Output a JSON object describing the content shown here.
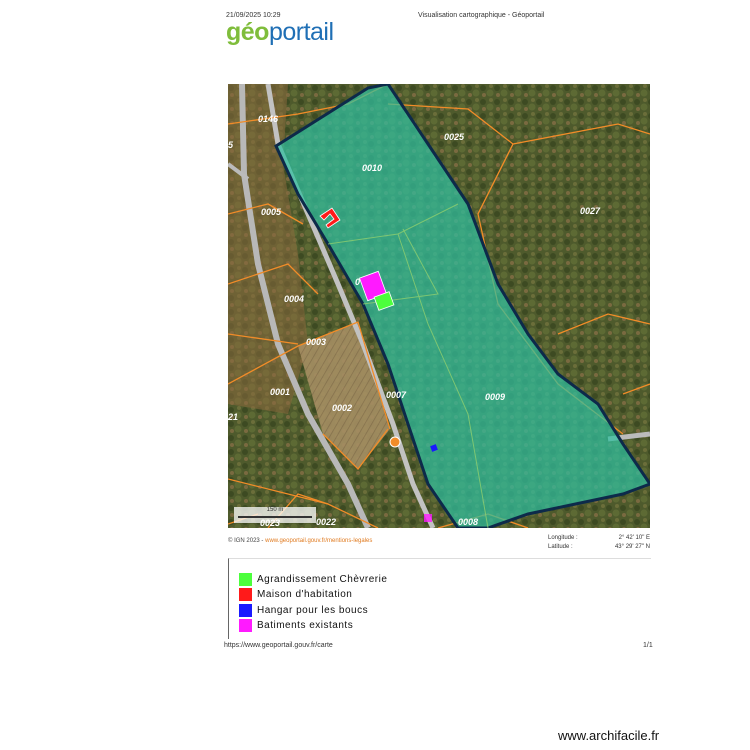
{
  "header": {
    "datetime": "21/09/2025 10:29",
    "page_title": "Visualisation cartographique - Géoportail",
    "logo_geo": "géo",
    "logo_portail": "portail"
  },
  "map": {
    "parcels": [
      {
        "id": "p0146",
        "label": "0146"
      },
      {
        "id": "p0025",
        "label": "0025"
      },
      {
        "id": "p0010",
        "label": "0010"
      },
      {
        "id": "p0005",
        "label": "0005"
      },
      {
        "id": "p0027",
        "label": "0027"
      },
      {
        "id": "p0004",
        "label": "0004"
      },
      {
        "id": "p0003",
        "label": "0003"
      },
      {
        "id": "p0001",
        "label": "0001"
      },
      {
        "id": "p0002",
        "label": "0002"
      },
      {
        "id": "p0007",
        "label": "0007"
      },
      {
        "id": "p0009",
        "label": "0009"
      },
      {
        "id": "p0023",
        "label": "0023"
      },
      {
        "id": "p0022",
        "label": "0022"
      },
      {
        "id": "p0008",
        "label": "0008"
      },
      {
        "id": "p21",
        "label": "21"
      },
      {
        "id": "p5",
        "label": "5"
      },
      {
        "id": "p0",
        "label": "0"
      }
    ],
    "colors": {
      "parcel_fill": "#2fbf9f",
      "parcel_outline": "#0d2a4a",
      "cadastre_lines": "#f28c28",
      "agrandissement": "#4cff3c",
      "maison": "#ff1a1a",
      "hangar": "#1a1aff",
      "batiments": "#ff1aff"
    },
    "scale_text": "150 m"
  },
  "credits": {
    "prefix": "© IGN 2023 - ",
    "link": "www.geoportail.gouv.fr/mentions-legales"
  },
  "coords": {
    "longitude_label": "Longitude :",
    "longitude_value": "2° 42' 10\" E",
    "latitude_label": "Latitude :",
    "latitude_value": "43° 29' 27\" N"
  },
  "legend": {
    "items": [
      {
        "label": "Agrandissement Chèvrerie",
        "color": "#4cff3c"
      },
      {
        "label": "Maison d'habitation",
        "color": "#ff1a1a"
      },
      {
        "label": "Hangar pour les boucs",
        "color": "#1a1aff"
      },
      {
        "label": "Batiments existants",
        "color": "#ff1aff"
      }
    ]
  },
  "footer": {
    "url": "https://www.geoportail.gouv.fr/carte",
    "page": "1/1"
  },
  "watermark": "www.archifacile.fr"
}
